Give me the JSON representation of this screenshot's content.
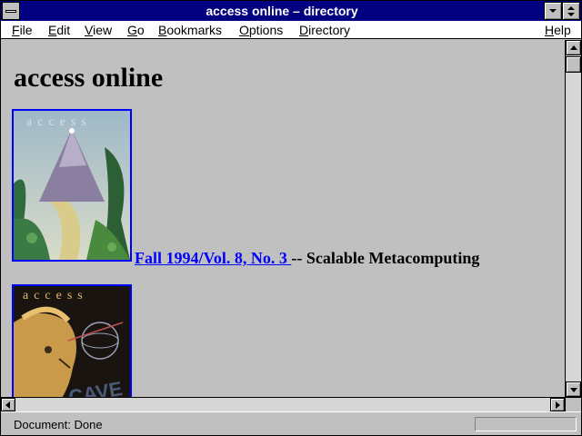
{
  "window": {
    "title": "access online – directory"
  },
  "menu": {
    "file": "File",
    "edit": "Edit",
    "view": "View",
    "go": "Go",
    "bookmarks": "Bookmarks",
    "options": "Options",
    "directory": "Directory",
    "help": "Help"
  },
  "content": {
    "heading": "access online",
    "issues": [
      {
        "cover_text": "access",
        "link_text": " Fall 1994/Vol. 8, No. 3 ",
        "separator": "--",
        "description": " Scalable Metacomputing"
      },
      {
        "cover_text": "access",
        "cover_graphic_text": "CAVE"
      }
    ]
  },
  "status": {
    "text": "Document: Done"
  },
  "colors": {
    "titlebar": "#000080",
    "background": "#c0c0c0",
    "link": "#0000ff"
  },
  "icons": [
    "system-menu-icon",
    "minimize-icon",
    "maximize-icon",
    "scroll-up-icon",
    "scroll-down-icon",
    "scroll-left-icon",
    "scroll-right-icon"
  ]
}
